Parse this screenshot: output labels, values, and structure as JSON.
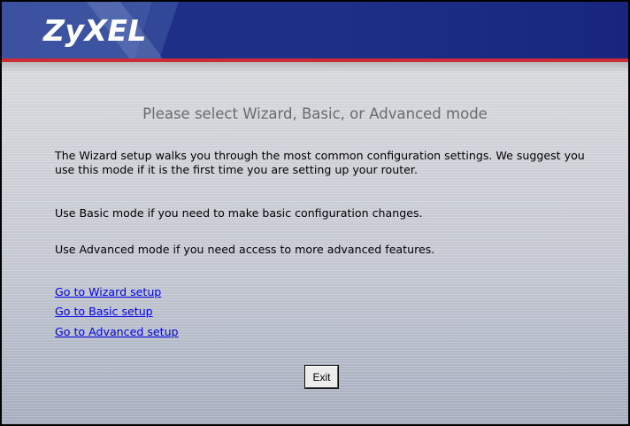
{
  "header": {
    "logo_text": "ZyXEL"
  },
  "main": {
    "title": "Please select Wizard, Basic, or Advanced mode",
    "paragraphs": [
      "The Wizard setup walks you through the most common configuration settings. We suggest you use this mode if it is the first time you are setting up your router.",
      "Use Basic mode if you need to make basic configuration changes.",
      "Use Advanced mode if you need access to more advanced features."
    ],
    "links": [
      "Go to Wizard setup",
      "Go to Basic setup",
      "Go to Advanced setup"
    ],
    "exit_label": "Exit"
  },
  "colors": {
    "header_blue": "#1e3189",
    "accent_red": "#cc2b38",
    "title_gray": "#6b6b6b",
    "link_blue": "#0000ee"
  }
}
